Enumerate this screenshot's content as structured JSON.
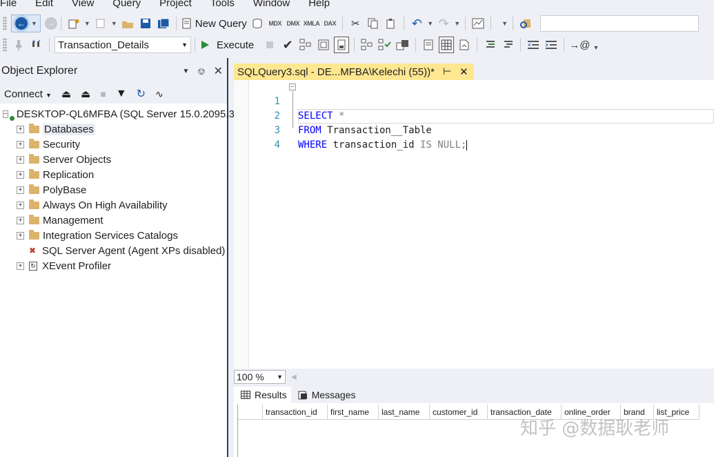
{
  "menu": [
    "File",
    "Edit",
    "View",
    "Query",
    "Project",
    "Tools",
    "Window",
    "Help"
  ],
  "toolbar1": {
    "new_query_label": "New Query",
    "mini_icons": [
      "MDX",
      "DMX",
      "XMLA",
      "DAX"
    ]
  },
  "toolbar2": {
    "database": "Transaction_Details",
    "execute_label": "Execute"
  },
  "object_explorer": {
    "title": "Object Explorer",
    "connect_label": "Connect",
    "server_node": "DESKTOP-QL6MFBA (SQL Server 15.0.2095.3",
    "nodes": [
      {
        "label": "Databases",
        "icon": "folder-icon",
        "expandable": true
      },
      {
        "label": "Security",
        "icon": "folder-icon",
        "expandable": true
      },
      {
        "label": "Server Objects",
        "icon": "folder-icon",
        "expandable": true
      },
      {
        "label": "Replication",
        "icon": "folder-icon",
        "expandable": true
      },
      {
        "label": "PolyBase",
        "icon": "folder-icon",
        "expandable": true
      },
      {
        "label": "Always On High Availability",
        "icon": "folder-icon",
        "expandable": true
      },
      {
        "label": "Management",
        "icon": "folder-icon",
        "expandable": true
      },
      {
        "label": "Integration Services Catalogs",
        "icon": "folder-icon",
        "expandable": true
      },
      {
        "label": "SQL Server Agent (Agent XPs disabled)",
        "icon": "agent-icon",
        "expandable": false
      },
      {
        "label": "XEvent Profiler",
        "icon": "xevent-icon",
        "expandable": true
      }
    ]
  },
  "editor": {
    "tab_title": "SQLQuery3.sql - DE...MFBA\\Kelechi (55))*",
    "lines": [
      {
        "num": "1",
        "kw": "SELECT",
        "rest": " *",
        "rest_gray": ""
      },
      {
        "num": "2",
        "kw": "FROM",
        "rest": " Transaction__Table",
        "rest_gray": ""
      },
      {
        "num": "3",
        "kw": "WHERE",
        "rest": " transaction_id ",
        "rest_gray": "IS NULL;"
      },
      {
        "num": "4",
        "kw": "",
        "rest": "",
        "rest_gray": ""
      }
    ],
    "zoom": "100 %"
  },
  "results": {
    "tabs": [
      "Results",
      "Messages"
    ],
    "columns": [
      "transaction_id",
      "first_name",
      "last_name",
      "customer_id",
      "transaction_date",
      "online_order",
      "brand",
      "list_price"
    ]
  },
  "watermark": "知乎 @数据耿老师"
}
